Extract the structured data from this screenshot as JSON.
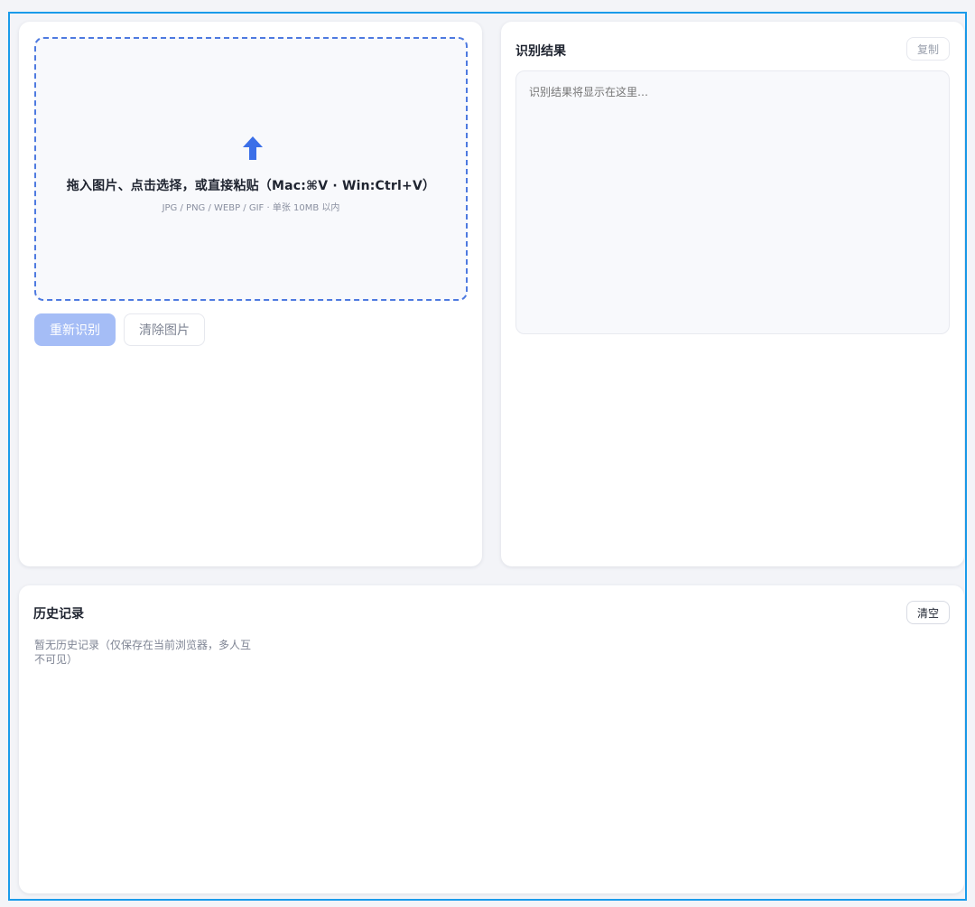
{
  "upload": {
    "title": "拖入图片、点击选择，或直接粘贴（Mac:⌘V · Win:Ctrl+V）",
    "hint": "JPG / PNG / WEBP / GIF · 单张 10MB 以内",
    "icon": "upload-arrow-icon",
    "accent_color": "#3b6fe8"
  },
  "actions": {
    "recognize_label": "重新识别",
    "clear_image_label": "清除图片"
  },
  "result": {
    "title": "识别结果",
    "copy_label": "复制",
    "placeholder": "识别结果将显示在这里…"
  },
  "history": {
    "title": "历史记录",
    "clear_label": "清空",
    "empty_text": "暂无历史记录（仅保存在当前浏览器，多人互不可见）"
  }
}
